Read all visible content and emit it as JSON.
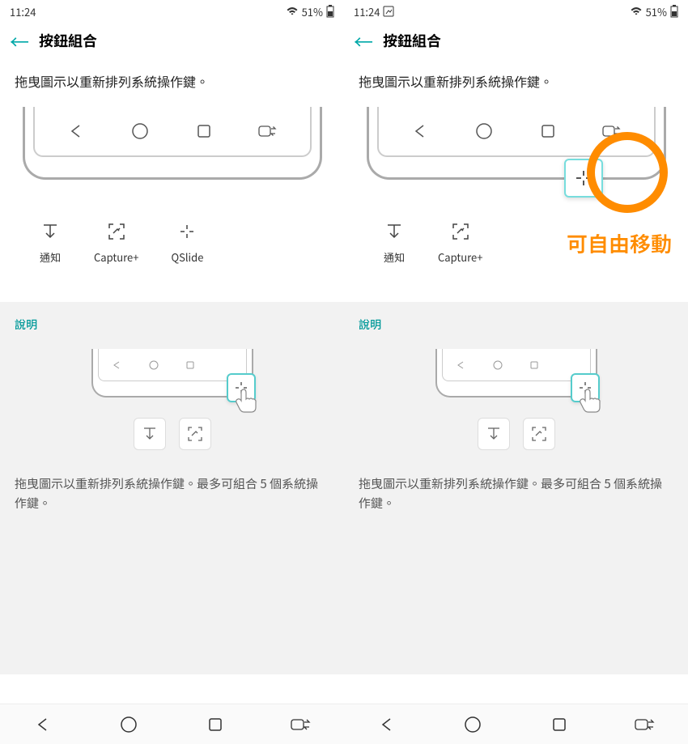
{
  "status": {
    "time": "11:24",
    "battery": "51%"
  },
  "header": {
    "title": "按鈕組合"
  },
  "content": {
    "instruction": "拖曳圖示以重新排列系統操作鍵。"
  },
  "drag_items": {
    "notify": "通知",
    "capture": "Capture+",
    "qslide": "QSlide"
  },
  "info": {
    "title": "說明",
    "desc": "拖曳圖示以重新排列系統操作鍵。最多可組合 5 個系統操作鍵。"
  },
  "annotation": {
    "text": "可自由移動"
  }
}
